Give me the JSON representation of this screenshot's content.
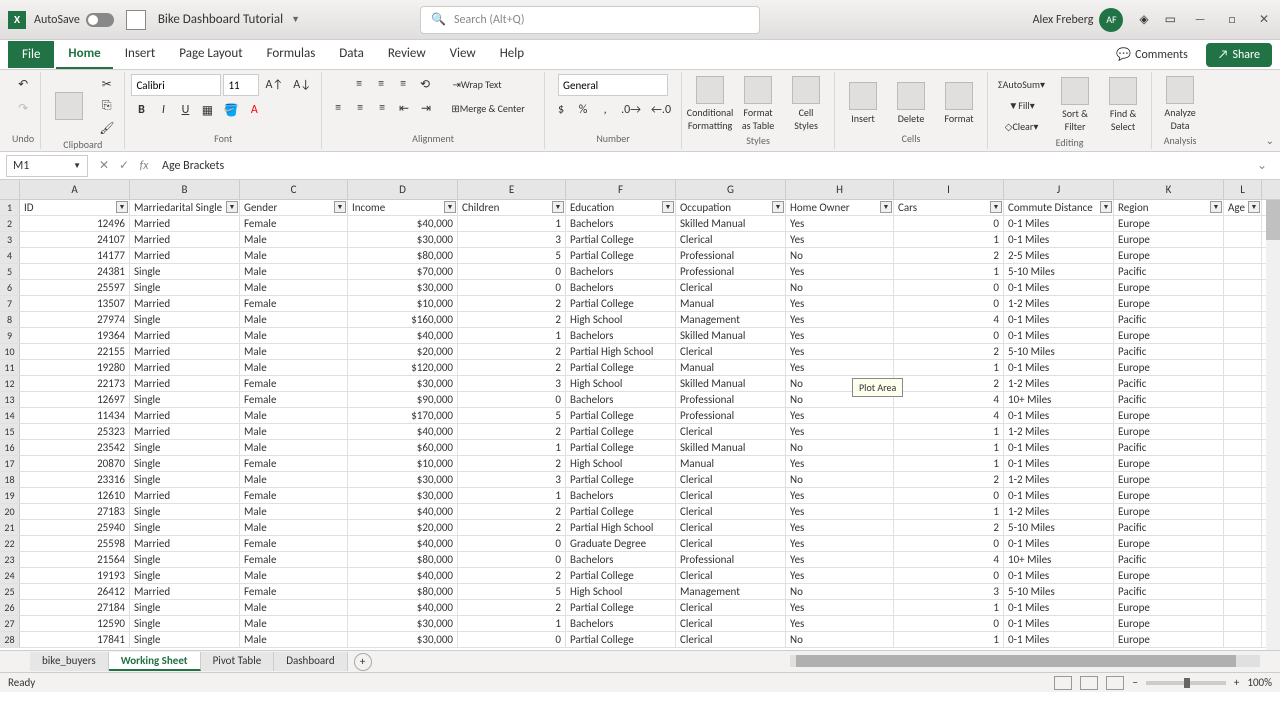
{
  "title": {
    "autosave": "AutoSave",
    "filename": "Bike Dashboard Tutorial",
    "search_placeholder": "Search (Alt+Q)",
    "user": "Alex Freberg",
    "user_initials": "AF"
  },
  "tabs": {
    "file": "File",
    "items": [
      "Home",
      "Insert",
      "Page Layout",
      "Formulas",
      "Data",
      "Review",
      "View",
      "Help"
    ],
    "active": "Home",
    "comments": "Comments",
    "share": "Share"
  },
  "ribbon": {
    "undo": "Undo",
    "clipboard": "Clipboard",
    "font": "Font",
    "alignment": "Alignment",
    "number": "Number",
    "styles": "Styles",
    "cells": "Cells",
    "editing": "Editing",
    "analysis": "Analysis",
    "font_name": "Calibri",
    "font_size": "11",
    "wrap": "Wrap Text",
    "merge": "Merge & Center",
    "num_format": "General",
    "cond_fmt": "Conditional Formatting",
    "fmt_table": "Format as Table",
    "cell_styles": "Cell Styles",
    "insert": "Insert",
    "delete": "Delete",
    "format": "Format",
    "autosum": "AutoSum",
    "fill": "Fill",
    "clear": "Clear",
    "sort": "Sort & Filter",
    "find": "Find & Select",
    "analyze": "Analyze Data"
  },
  "formula_bar": {
    "name_box": "M1",
    "formula": "Age Brackets"
  },
  "columns": [
    "A",
    "B",
    "C",
    "D",
    "E",
    "F",
    "G",
    "H",
    "I",
    "J",
    "K",
    "L"
  ],
  "headers": [
    "ID",
    "Marriedarital Single",
    "Gender",
    "Income",
    "Children",
    "Education",
    "Occupation",
    "Home Owner",
    "Cars",
    "Commute Distance",
    "Region",
    "Age"
  ],
  "rows": [
    [
      "12496",
      "Married",
      "Female",
      "$40,000",
      "1",
      "Bachelors",
      "Skilled Manual",
      "Yes",
      "0",
      "0-1 Miles",
      "Europe",
      ""
    ],
    [
      "24107",
      "Married",
      "Male",
      "$30,000",
      "3",
      "Partial College",
      "Clerical",
      "Yes",
      "1",
      "0-1 Miles",
      "Europe",
      ""
    ],
    [
      "14177",
      "Married",
      "Male",
      "$80,000",
      "5",
      "Partial College",
      "Professional",
      "No",
      "2",
      "2-5 Miles",
      "Europe",
      ""
    ],
    [
      "24381",
      "Single",
      "Male",
      "$70,000",
      "0",
      "Bachelors",
      "Professional",
      "Yes",
      "1",
      "5-10 Miles",
      "Pacific",
      ""
    ],
    [
      "25597",
      "Single",
      "Male",
      "$30,000",
      "0",
      "Bachelors",
      "Clerical",
      "No",
      "0",
      "0-1 Miles",
      "Europe",
      ""
    ],
    [
      "13507",
      "Married",
      "Female",
      "$10,000",
      "2",
      "Partial College",
      "Manual",
      "Yes",
      "0",
      "1-2 Miles",
      "Europe",
      ""
    ],
    [
      "27974",
      "Single",
      "Male",
      "$160,000",
      "2",
      "High School",
      "Management",
      "Yes",
      "4",
      "0-1 Miles",
      "Pacific",
      ""
    ],
    [
      "19364",
      "Married",
      "Male",
      "$40,000",
      "1",
      "Bachelors",
      "Skilled Manual",
      "Yes",
      "0",
      "0-1 Miles",
      "Europe",
      ""
    ],
    [
      "22155",
      "Married",
      "Male",
      "$20,000",
      "2",
      "Partial High School",
      "Clerical",
      "Yes",
      "2",
      "5-10 Miles",
      "Pacific",
      ""
    ],
    [
      "19280",
      "Married",
      "Male",
      "$120,000",
      "2",
      "Partial College",
      "Manual",
      "Yes",
      "1",
      "0-1 Miles",
      "Europe",
      ""
    ],
    [
      "22173",
      "Married",
      "Female",
      "$30,000",
      "3",
      "High School",
      "Skilled Manual",
      "No",
      "2",
      "1-2 Miles",
      "Pacific",
      ""
    ],
    [
      "12697",
      "Single",
      "Female",
      "$90,000",
      "0",
      "Bachelors",
      "Professional",
      "No",
      "4",
      "10+ Miles",
      "Pacific",
      ""
    ],
    [
      "11434",
      "Married",
      "Male",
      "$170,000",
      "5",
      "Partial College",
      "Professional",
      "Yes",
      "4",
      "0-1 Miles",
      "Europe",
      ""
    ],
    [
      "25323",
      "Married",
      "Male",
      "$40,000",
      "2",
      "Partial College",
      "Clerical",
      "Yes",
      "1",
      "1-2 Miles",
      "Europe",
      ""
    ],
    [
      "23542",
      "Single",
      "Male",
      "$60,000",
      "1",
      "Partial College",
      "Skilled Manual",
      "No",
      "1",
      "0-1 Miles",
      "Pacific",
      ""
    ],
    [
      "20870",
      "Single",
      "Female",
      "$10,000",
      "2",
      "High School",
      "Manual",
      "Yes",
      "1",
      "0-1 Miles",
      "Europe",
      ""
    ],
    [
      "23316",
      "Single",
      "Male",
      "$30,000",
      "3",
      "Partial College",
      "Clerical",
      "No",
      "2",
      "1-2 Miles",
      "Europe",
      ""
    ],
    [
      "12610",
      "Married",
      "Female",
      "$30,000",
      "1",
      "Bachelors",
      "Clerical",
      "Yes",
      "0",
      "0-1 Miles",
      "Europe",
      ""
    ],
    [
      "27183",
      "Single",
      "Male",
      "$40,000",
      "2",
      "Partial College",
      "Clerical",
      "Yes",
      "1",
      "1-2 Miles",
      "Europe",
      ""
    ],
    [
      "25940",
      "Single",
      "Male",
      "$20,000",
      "2",
      "Partial High School",
      "Clerical",
      "Yes",
      "2",
      "5-10 Miles",
      "Pacific",
      ""
    ],
    [
      "25598",
      "Married",
      "Female",
      "$40,000",
      "0",
      "Graduate Degree",
      "Clerical",
      "Yes",
      "0",
      "0-1 Miles",
      "Europe",
      ""
    ],
    [
      "21564",
      "Single",
      "Female",
      "$80,000",
      "0",
      "Bachelors",
      "Professional",
      "Yes",
      "4",
      "10+ Miles",
      "Pacific",
      ""
    ],
    [
      "19193",
      "Single",
      "Male",
      "$40,000",
      "2",
      "Partial College",
      "Clerical",
      "Yes",
      "0",
      "0-1 Miles",
      "Europe",
      ""
    ],
    [
      "26412",
      "Married",
      "Female",
      "$80,000",
      "5",
      "High School",
      "Management",
      "No",
      "3",
      "5-10 Miles",
      "Pacific",
      ""
    ],
    [
      "27184",
      "Single",
      "Male",
      "$40,000",
      "2",
      "Partial College",
      "Clerical",
      "Yes",
      "1",
      "0-1 Miles",
      "Europe",
      ""
    ],
    [
      "12590",
      "Single",
      "Male",
      "$30,000",
      "1",
      "Bachelors",
      "Clerical",
      "Yes",
      "0",
      "0-1 Miles",
      "Europe",
      ""
    ],
    [
      "17841",
      "Single",
      "Male",
      "$30,000",
      "0",
      "Partial College",
      "Clerical",
      "No",
      "1",
      "0-1 Miles",
      "Europe",
      ""
    ]
  ],
  "tooltip": "Plot Area",
  "sheets": {
    "items": [
      "bike_buyers",
      "Working Sheet",
      "Pivot Table",
      "Dashboard"
    ],
    "active": "Working Sheet"
  },
  "status": {
    "ready": "Ready",
    "zoom": "100%"
  }
}
